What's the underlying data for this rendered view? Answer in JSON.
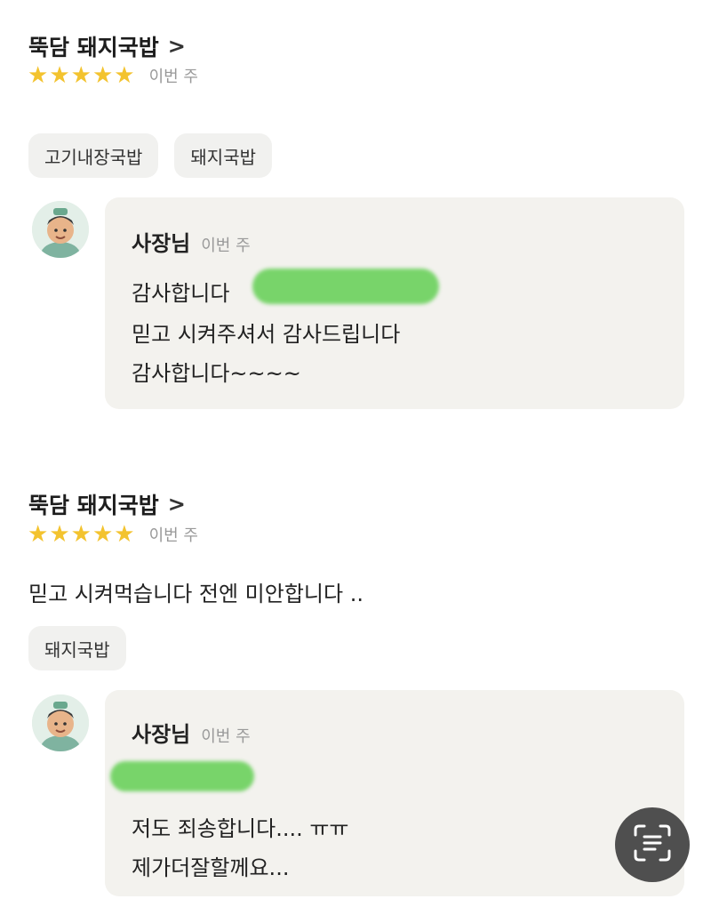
{
  "reviews": [
    {
      "store": "뚝담 돼지국밥",
      "chevron": ">",
      "rating": 5,
      "date": "이번 주",
      "text": "",
      "chips": [
        "고기내장국밥",
        "돼지국밥"
      ],
      "reply": {
        "owner": "사장님",
        "date": "이번 주",
        "lines": [
          "감사합니다",
          "믿고 시켜주셔서 감사드립니다",
          "감사합니다~~~~"
        ]
      }
    },
    {
      "store": "뚝담 돼지국밥",
      "chevron": ">",
      "rating": 5,
      "date": "이번 주",
      "text": "믿고 시켜먹습니다 전엔 미안합니다 ..",
      "chips": [
        "돼지국밥"
      ],
      "reply": {
        "owner": "사장님",
        "date": "이번 주",
        "lines": [
          "",
          "저도 죄송합니다.... ㅠㅠ",
          "제가더잘할께요..."
        ]
      }
    }
  ],
  "colors": {
    "star": "#f3c32f",
    "redaction": "#78d46a",
    "reply_bg": "#f3f2ee",
    "chip_bg": "#f1f1ef"
  },
  "icons": {
    "star": "star-icon",
    "scan": "text-scan-icon",
    "chevron": "chevron-right-icon"
  }
}
